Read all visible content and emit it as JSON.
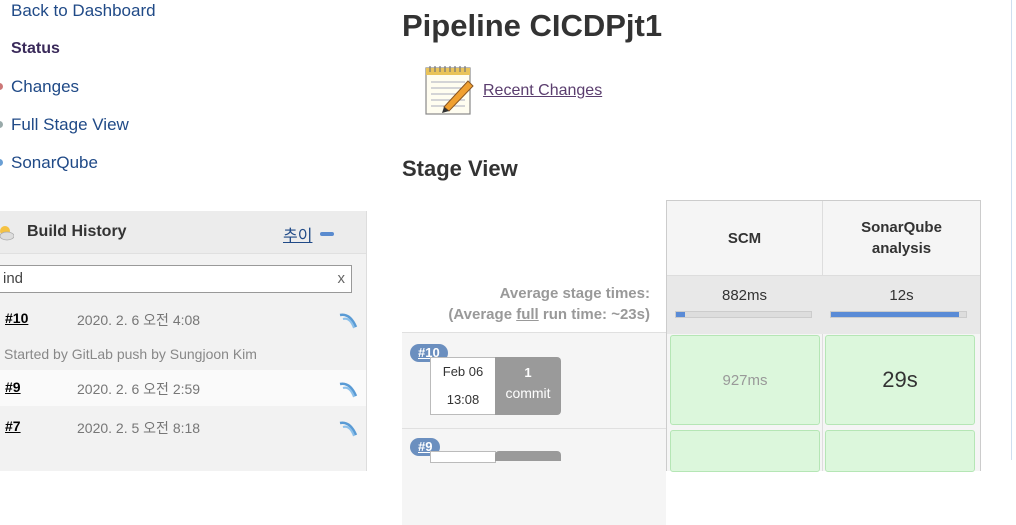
{
  "sidebar": {
    "items": [
      {
        "label": "Back to Dashboard"
      },
      {
        "label": "Status"
      },
      {
        "label": "Changes"
      },
      {
        "label": "Full Stage View"
      },
      {
        "label": "SonarQube"
      }
    ]
  },
  "build_history": {
    "title": "Build History",
    "trend_label": "추이",
    "filter_value": "ind",
    "filter_clear": "x",
    "builds": [
      {
        "number": "#10",
        "date": "2020. 2. 6 오전 4:08",
        "cause": "Started by GitLab push by Sungjoon Kim"
      },
      {
        "number": "#9",
        "date": "2020. 2. 6 오전 2:59"
      },
      {
        "number": "#7",
        "date": "2020. 2. 5 오전 8:18"
      }
    ]
  },
  "main": {
    "title": "Pipeline CICDPjt1",
    "recent_changes": "Recent Changes",
    "stage_view_heading": "Stage View"
  },
  "stage_view": {
    "average_label": "Average stage times:",
    "average_full_prefix": "(Average ",
    "average_full_word": "full",
    "average_full_suffix": " run time: ~23s)",
    "stages": [
      {
        "name": "SCM",
        "avg": "882ms",
        "avg_fraction": 0.07
      },
      {
        "name": "SonarQube analysis",
        "avg": "12s",
        "avg_fraction": 0.95
      }
    ],
    "runs": [
      {
        "badge": "#10",
        "date": "Feb 06",
        "time": "13:08",
        "commits_count": "1",
        "commits_label": "commit",
        "durations": [
          "927ms",
          "29s"
        ]
      },
      {
        "badge": "#9"
      }
    ]
  },
  "colors": {
    "link": "#204a87",
    "success_cell": "#dcf7dc",
    "badge": "#6b8fbf",
    "progress": "#5a8bd6"
  }
}
